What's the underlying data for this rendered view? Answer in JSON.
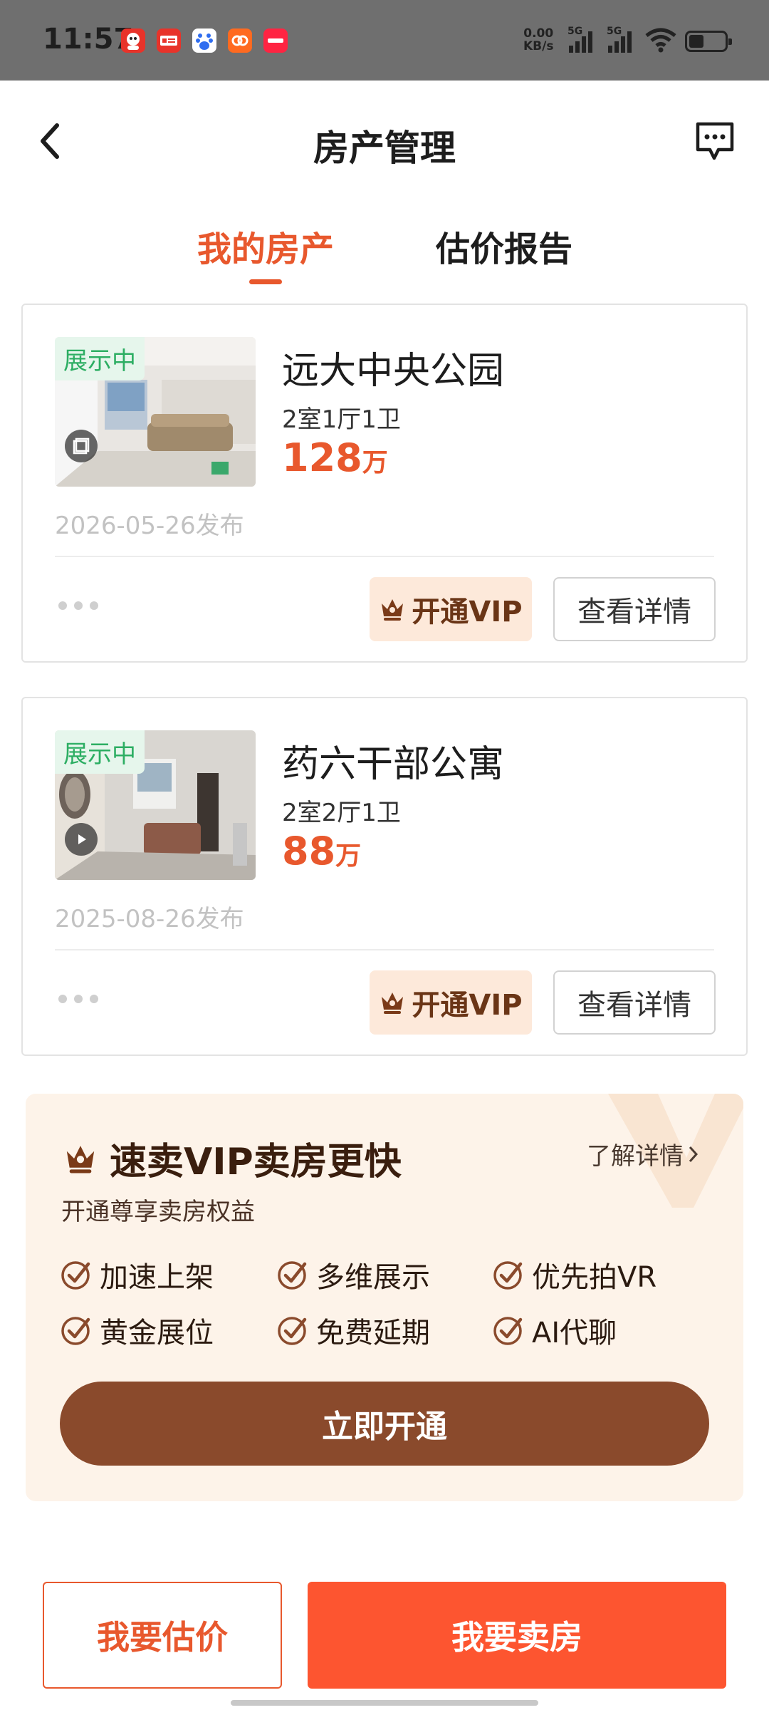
{
  "status_bar": {
    "time": "11:57",
    "net_speed_value": "0.00",
    "net_speed_unit": "KB/s",
    "signal1": "5G",
    "signal2": "5G",
    "app_icons": [
      "red-mascot-app-icon",
      "toutiao-app-icon",
      "baidu-app-icon",
      "orange-app-icon",
      "xiaohongshu-app-icon"
    ],
    "colors": {
      "background": "#6f6f6f"
    }
  },
  "header": {
    "title": "房产管理",
    "icons": {
      "back": "chevron-left-icon",
      "message": "chat-bubble-icon"
    }
  },
  "tabs": [
    {
      "label": "我的房产",
      "active": true
    },
    {
      "label": "估价报告",
      "active": false
    }
  ],
  "properties": [
    {
      "status_badge": "展示中",
      "name": "远大中央公园",
      "layout": "2室1厅1卫",
      "price_value": "128",
      "price_unit": "万",
      "publish_date": "2026-05-26发布",
      "media_icon": "photo-album-icon",
      "vip_label": "开通VIP",
      "detail_label": "查看详情"
    },
    {
      "status_badge": "展示中",
      "name": "药六干部公寓",
      "layout": "2室2厅1卫",
      "price_value": "88",
      "price_unit": "万",
      "publish_date": "2025-08-26发布",
      "media_icon": "play-icon",
      "vip_label": "开通VIP",
      "detail_label": "查看详情"
    }
  ],
  "vip_promo": {
    "title": "速卖VIP卖房更快",
    "subtitle": "开通尊享卖房权益",
    "learn_more": "了解详情",
    "benefits": [
      "加速上架",
      "多维展示",
      "优先拍VR",
      "黄金展位",
      "免费延期",
      "AI代聊"
    ],
    "cta": "立即开通"
  },
  "bottom_actions": {
    "estimate": "我要估价",
    "sell": "我要卖房"
  },
  "colors": {
    "accent": "#e8582d",
    "sell_button": "#fd5530",
    "vip_button": "#8a4a2c",
    "vip_panel_bg": "#fdf3e9",
    "badge_green": "#2dae63"
  }
}
